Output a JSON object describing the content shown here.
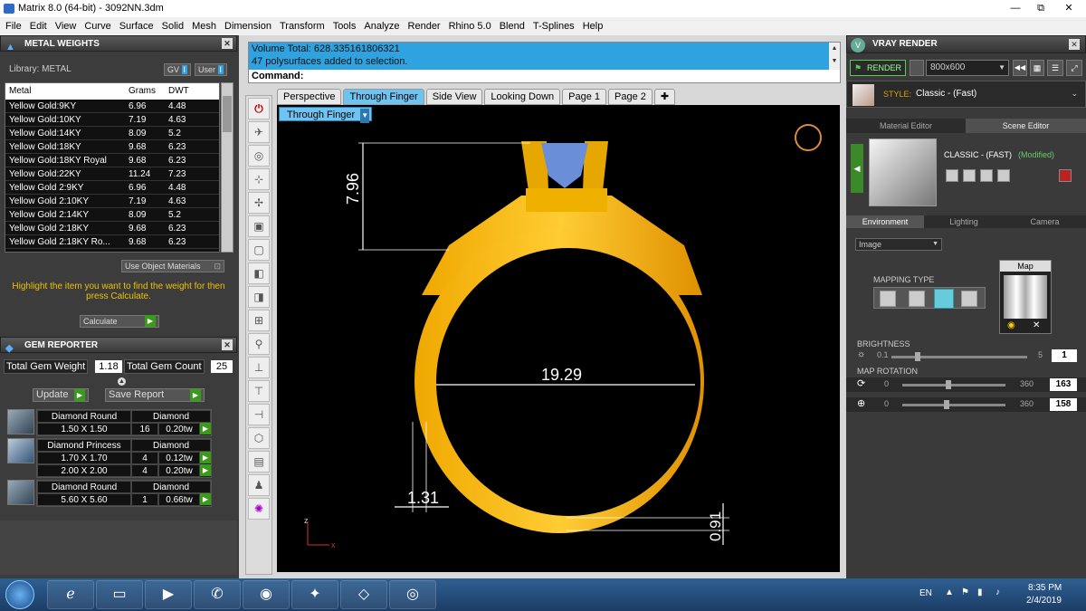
{
  "window": {
    "title": "Matrix 8.0 (64-bit) - 3092NN.3dm",
    "min": "—",
    "max": "⧉",
    "close": "✕"
  },
  "menu": [
    "File",
    "Edit",
    "View",
    "Curve",
    "Surface",
    "Solid",
    "Mesh",
    "Dimension",
    "Transform",
    "Tools",
    "Analyze",
    "Render",
    "Rhino 5.0",
    "Blend",
    "T-Splines",
    "Help"
  ],
  "metal_weights": {
    "title": "METAL WEIGHTS",
    "library_label": "Library: METAL",
    "gv_label": "GV",
    "user_label": "User",
    "columns": [
      "Metal",
      "Grams",
      "DWT"
    ],
    "rows": [
      [
        "Yellow Gold:9KY",
        "6.96",
        "4.48"
      ],
      [
        "Yellow Gold:10KY",
        "7.19",
        "4.63"
      ],
      [
        "Yellow Gold:14KY",
        "8.09",
        "5.2"
      ],
      [
        "Yellow Gold:18KY",
        "9.68",
        "6.23"
      ],
      [
        "Yellow Gold:18KY Royal",
        "9.68",
        "6.23"
      ],
      [
        "Yellow Gold:22KY",
        "11.24",
        "7.23"
      ],
      [
        "Yellow Gold 2:9KY",
        "6.96",
        "4.48"
      ],
      [
        "Yellow Gold 2:10KY",
        "7.19",
        "4.63"
      ],
      [
        "Yellow Gold 2:14KY",
        "8.09",
        "5.2"
      ],
      [
        "Yellow Gold 2:18KY",
        "9.68",
        "6.23"
      ],
      [
        "Yellow Gold 2:18KY Ro...",
        "9.68",
        "6.23"
      ]
    ],
    "use_object_materials": "Use Object Materials",
    "hint": "Highlight the item you want to find the weight for then press Calculate.",
    "calculate": "Calculate"
  },
  "gem_reporter": {
    "title": "GEM REPORTER",
    "total_weight_label": "Total Gem Weight",
    "total_weight": "1.18",
    "total_count_label": "Total Gem Count",
    "total_count": "25",
    "update": "Update",
    "save_report": "Save Report",
    "gems": [
      {
        "name": "Diamond Round",
        "type": "Diamond",
        "rows": [
          [
            "1.50 X 1.50",
            "16",
            "0.20tw"
          ]
        ]
      },
      {
        "name": "Diamond Princess",
        "type": "Diamond",
        "rows": [
          [
            "1.70 X 1.70",
            "4",
            "0.12tw"
          ],
          [
            "2.00 X 2.00",
            "4",
            "0.20tw"
          ]
        ]
      },
      {
        "name": "Diamond Round",
        "type": "Diamond",
        "rows": [
          [
            "5.60 X 5.60",
            "1",
            "0.66tw"
          ]
        ]
      }
    ]
  },
  "command": {
    "history": [
      "Volume Total: 628.335161806321",
      "47 polysurfaces added to selection."
    ],
    "prompt": "Command:"
  },
  "tabs": [
    "Perspective",
    "Through Finger",
    "Side View",
    "Looking Down",
    "Page 1",
    "Page 2"
  ],
  "active_tab": "Through Finger",
  "viewport": {
    "label": "Through Finger",
    "dims": {
      "height": "7.96",
      "inner": "19.29",
      "shank": "1.31",
      "bottom": "0.91"
    },
    "axis_z": "z",
    "axis_x": "x"
  },
  "vray": {
    "title": "VRAY RENDER",
    "render": "RENDER",
    "resolution": "800x600",
    "style_label": "STYLE:",
    "style_value": "Classic - (Fast)",
    "tabs": [
      "Material Editor",
      "Scene Editor"
    ],
    "preset": "CLASSIC - (FAST)",
    "modified": "(Modified)",
    "env_tabs": [
      "Environment",
      "Lighting",
      "Camera"
    ],
    "env_type": "Image",
    "mapping_type": "MAPPING TYPE",
    "map_label": "Map",
    "brightness_label": "BRIGHTNESS",
    "brightness_min": "0.1",
    "brightness_max": "5",
    "brightness_value": "1",
    "map_rotation_label": "MAP ROTATION",
    "rot1_min": "0",
    "rot1_max": "360",
    "rot1_value": "163",
    "rot2_min": "0",
    "rot2_max": "360",
    "rot2_value": "158"
  },
  "taskbar": {
    "lang": "EN",
    "time": "8:35 PM",
    "date": "2/4/2019"
  }
}
